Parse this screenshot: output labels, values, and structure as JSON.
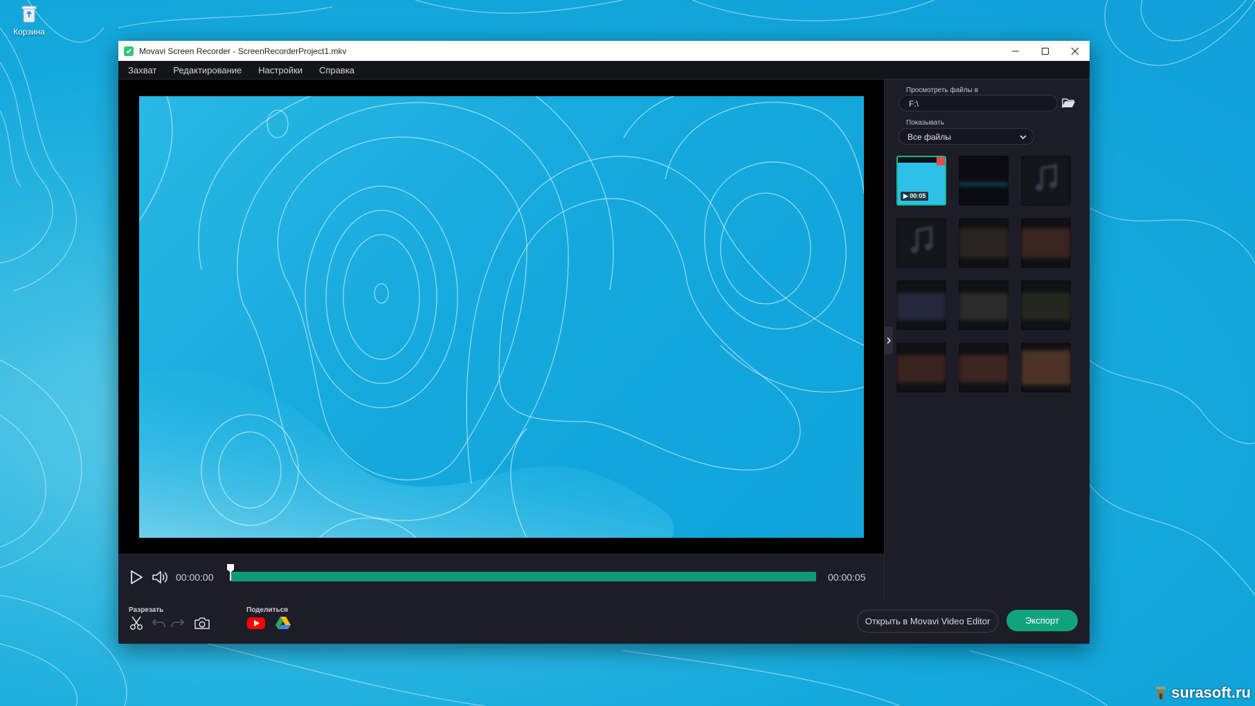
{
  "desktop": {
    "recycle_bin_label": "Корзина",
    "watermark": "surasoft.ru"
  },
  "window": {
    "title": "Movavi Screen Recorder - ScreenRecorderProject1.mkv",
    "menu": [
      "Захват",
      "Редактирование",
      "Настройки",
      "Справка"
    ]
  },
  "player": {
    "current_time": "00:00:00",
    "end_time": "00:00:05",
    "progress": 0
  },
  "toolbar": {
    "cut_label": "Разрезать",
    "share_label": "Поделиться",
    "open_editor_label": "Открыть в Movavi Video Editor",
    "export_label": "Экспорт"
  },
  "files_panel": {
    "browse_label": "Просмотреть файлы в",
    "path_value": "F:\\",
    "show_label": "Показывать",
    "filter_value": "Все файлы",
    "selected_duration": "00:05"
  },
  "colors": {
    "accent": "#11a37f",
    "progress_track": "#0f9a74",
    "window_bg": "#1c1d27"
  }
}
